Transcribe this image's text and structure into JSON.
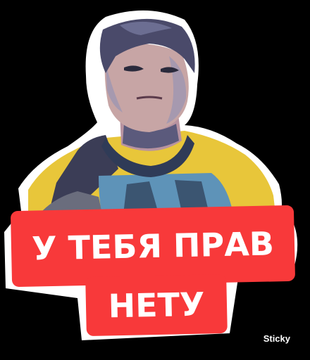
{
  "caption": {
    "line1": "У ТЕБЯ ПРАВ",
    "line2": "НЕТУ"
  },
  "watermark": "Sticky",
  "colors": {
    "background": "#000000",
    "outline": "#ffffff",
    "caption_bg": "#f8393a",
    "caption_text": "#ffffff",
    "shirt_yellow": "#e8c63a",
    "shirt_blue": "#5e93b8",
    "skin": "#c7a5a5",
    "hair": "#4a4a6a"
  }
}
